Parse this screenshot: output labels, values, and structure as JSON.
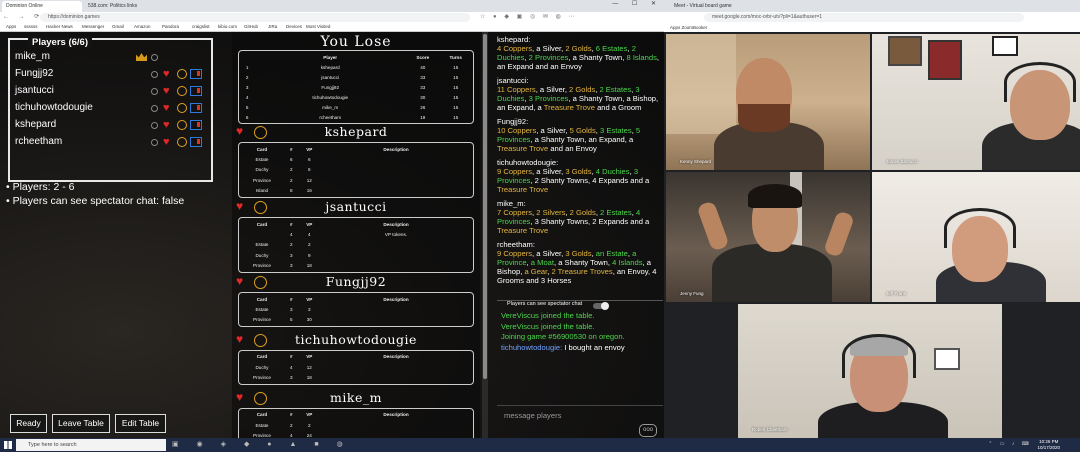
{
  "browser": {
    "tabs": [
      "Dominion Online",
      "538.com: Politics links"
    ],
    "url": "https://dominion.games",
    "bookmarks": [
      "Apps",
      "ssssss",
      "Hacker News",
      "Messenger",
      "Gmail",
      "Amazon",
      "Pandora",
      "craigslist",
      "kibio.com",
      "GitHub",
      "JIRa",
      "Devices",
      "Most Visited"
    ]
  },
  "players_panel": {
    "title": "Players (6/6)",
    "players": [
      "mike_m",
      "Fungjj92",
      "jsantucci",
      "tichuhowtodougie",
      "kshepard",
      "rcheetham"
    ]
  },
  "info": {
    "players_line": "• Players: 2 - 6",
    "spectator_line": "• Players can see spectator chat: false"
  },
  "buttons": {
    "ready": "Ready",
    "leave": "Leave Table",
    "edit": "Edit Table"
  },
  "scoreboard": {
    "title": "You Lose",
    "headers": [
      "",
      "Player",
      "Score",
      "Turns"
    ],
    "rows": [
      [
        "1",
        "kshepard",
        "40",
        "15"
      ],
      [
        "2",
        "jsantucci",
        "33",
        "15"
      ],
      [
        "3",
        "Fungjj92",
        "33",
        "15"
      ],
      [
        "4",
        "tichuhowtodougie",
        "30",
        "15"
      ],
      [
        "5",
        "mike_m",
        "26",
        "15"
      ],
      [
        "6",
        "rcheetham",
        "19",
        "15"
      ]
    ]
  },
  "card_headers": [
    "Card",
    "#",
    "VP",
    "Description"
  ],
  "sections": [
    {
      "name": "kshepard",
      "rows": [
        [
          "Estate",
          "6",
          "6",
          ""
        ],
        [
          "Duchy",
          "2",
          "6",
          ""
        ],
        [
          "Province",
          "2",
          "12",
          ""
        ],
        [
          "Island",
          "8",
          "16",
          ""
        ]
      ]
    },
    {
      "name": "jsantucci",
      "rows": [
        [
          "",
          "4",
          "4",
          "VP tokens."
        ],
        [
          "Estate",
          "2",
          "2",
          ""
        ],
        [
          "Duchy",
          "3",
          "9",
          ""
        ],
        [
          "Province",
          "3",
          "18",
          ""
        ]
      ]
    },
    {
      "name": "Fungjj92",
      "rows": [
        [
          "Estate",
          "3",
          "3",
          ""
        ],
        [
          "Province",
          "5",
          "30",
          ""
        ]
      ]
    },
    {
      "name": "tichuhowtodougie",
      "rows": [
        [
          "Duchy",
          "4",
          "12",
          ""
        ],
        [
          "Province",
          "3",
          "18",
          ""
        ]
      ]
    },
    {
      "name": "mike_m",
      "rows": [
        [
          "Estate",
          "2",
          "2",
          ""
        ],
        [
          "Province",
          "4",
          "24",
          ""
        ]
      ]
    },
    {
      "name": "rcheetham",
      "rows": []
    }
  ],
  "log": {
    "entries": [
      {
        "who": "kshepard:",
        "html": "<span class='cop'>4 Coppers</span>, a Silver, <span class='cop'>2 Golds</span>, <span class='gr'>6 Estates</span>, <span class='gr'>2 Duchies</span>, <span class='gr'>2 Provinces</span>, a Shanty Town, <span class='gr'>8 Islands</span>, an Expand and an Envoy"
      },
      {
        "who": "jsantucci:",
        "html": "<span class='cop'>11 Coppers</span>, a Silver, <span class='cop'>2 Golds</span>, <span class='gr'>2 Estates</span>, <span class='gr'>3 Duchies</span>, <span class='gr'>3 Provinces</span>, a Shanty Town, a Bishop, an Expand, a <span class='cop'>Treasure Trove</span> and a Groom"
      },
      {
        "who": "Fungjj92:",
        "html": "<span class='cop'>10 Coppers</span>, a Silver, <span class='cop'>5 Golds</span>, <span class='gr'>3 Estates</span>, <span class='gr'>5 Provinces</span>, a Shanty Town, an Expand, a <span class='cop'>Treasure Trove</span> and an Envoy"
      },
      {
        "who": "tichuhowtodougie:",
        "html": "<span class='cop'>9 Coppers</span>, a Silver, <span class='cop'>3 Golds</span>, <span class='gr'>4 Duchies</span>, <span class='gr'>3 Provinces</span>, 2 Shanty Towns, 4 Expands and a <span class='cop'>Treasure Trove</span>"
      },
      {
        "who": "mike_m:",
        "html": "<span class='cop'>7 Coppers</span>, <span class='cop'>2 Silvers</span>, <span class='cop'>2 Golds</span>, <span class='gr'>2 Estates</span>, <span class='gr'>4 Provinces</span>, 3 Shanty Towns, 2 Expands and a <span class='cop'>Treasure Trove</span>"
      },
      {
        "who": "rcheetham:",
        "html": "<span class='cop'>9 Coppers</span>, a Silver, <span class='cop'>3 Golds</span>, <span class='gr'>an Estate</span>, <span class='gr'>a Province</span>, <span class='gr'>a Moat</span>, a Shanty Town, <span class='gr'>4 Islands</span>, a Bishop, <span class='cop'>a Gear</span>, <span class='cop'>2 Treasure Troves</span>, an Envoy, 4 Grooms and 3 Horses"
      }
    ]
  },
  "spectator_toggle_label": "Players can see spectator chat",
  "chat": [
    {
      "type": "sys",
      "text": "VereViscus joined the table."
    },
    {
      "type": "sys",
      "text": "VereViscus joined the table."
    },
    {
      "type": "sys",
      "text": "Joining game #56900530 on oregon."
    },
    {
      "type": "msg",
      "user": "tichuhowtodougie:",
      "text": " I bought an envoy"
    }
  ],
  "message_placeholder": "message players",
  "send_label": "ooo",
  "meet": {
    "tab": "Meet - Virtual board game",
    "url": "meet.google.com/moc-orbr-utv?pli=1&authuser=1",
    "bookmarks": "Apps  ZoomBooker",
    "participants": [
      "Kenny Shepard",
      "James Santucci",
      "Jenny Fung",
      "Jeff Franti",
      "Robert Cheetham"
    ]
  },
  "taskbar": {
    "search": "Type here to search",
    "time": "10:26 PM",
    "date": "10/17/2020"
  }
}
